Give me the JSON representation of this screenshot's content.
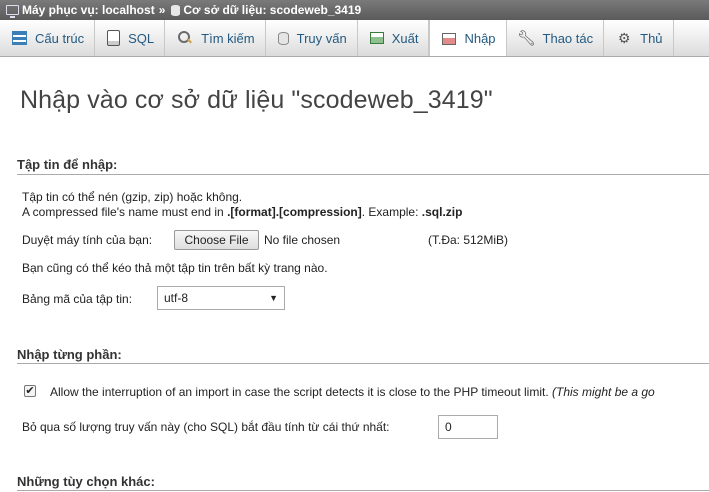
{
  "breadcrumb": {
    "server": "Máy phục vụ: localhost",
    "separator": "»",
    "database": "Cơ sở dữ liệu: scodeweb_3419"
  },
  "tabs": [
    {
      "label": "Cấu trúc",
      "icon": "structure-icon"
    },
    {
      "label": "SQL",
      "icon": "sql-icon"
    },
    {
      "label": "Tìm kiếm",
      "icon": "search-icon"
    },
    {
      "label": "Truy vấn",
      "icon": "query-icon"
    },
    {
      "label": "Xuất",
      "icon": "export-icon"
    },
    {
      "label": "Nhập",
      "icon": "import-icon",
      "active": true
    },
    {
      "label": "Thao tác",
      "icon": "wrench-icon"
    },
    {
      "label": "Thủ",
      "icon": "routines-icon"
    }
  ],
  "page": {
    "title": "Nhập vào cơ sở dữ liệu \"scodeweb_3419\""
  },
  "file_section": {
    "legend": "Tập tin để nhập:",
    "line1": "Tập tin có thể nén (gzip, zip) hoặc không.",
    "line2_prefix": "A compressed file's name must end in ",
    "line2_format": ".[format].[compression]",
    "line2_mid": ". Example: ",
    "line2_example": ".sql.zip",
    "browse_label": "Duyệt máy tính của bạn:",
    "choose_file_button": "Choose File",
    "no_file_text": "No file chosen",
    "max_size": "(T.Đa: 512MiB)",
    "drag_hint": "Bạn cũng có thể kéo thả một tập tin trên bất kỳ trang nào.",
    "charset_label": "Bảng mã của tập tin:",
    "charset_value": "utf-8"
  },
  "partial_section": {
    "legend": "Nhập từng phần:",
    "allow_interrupt_text": "Allow the interruption of an import in case the script detects it is close to the PHP timeout limit.",
    "allow_interrupt_note": "(This might be a go",
    "allow_interrupt_checked": true,
    "skip_label": "Bỏ qua số lượng truy vấn này (cho SQL) bắt đầu tính từ cái thứ nhất:",
    "skip_value": "0"
  },
  "other_section": {
    "legend": "Những tùy chọn khác:"
  }
}
